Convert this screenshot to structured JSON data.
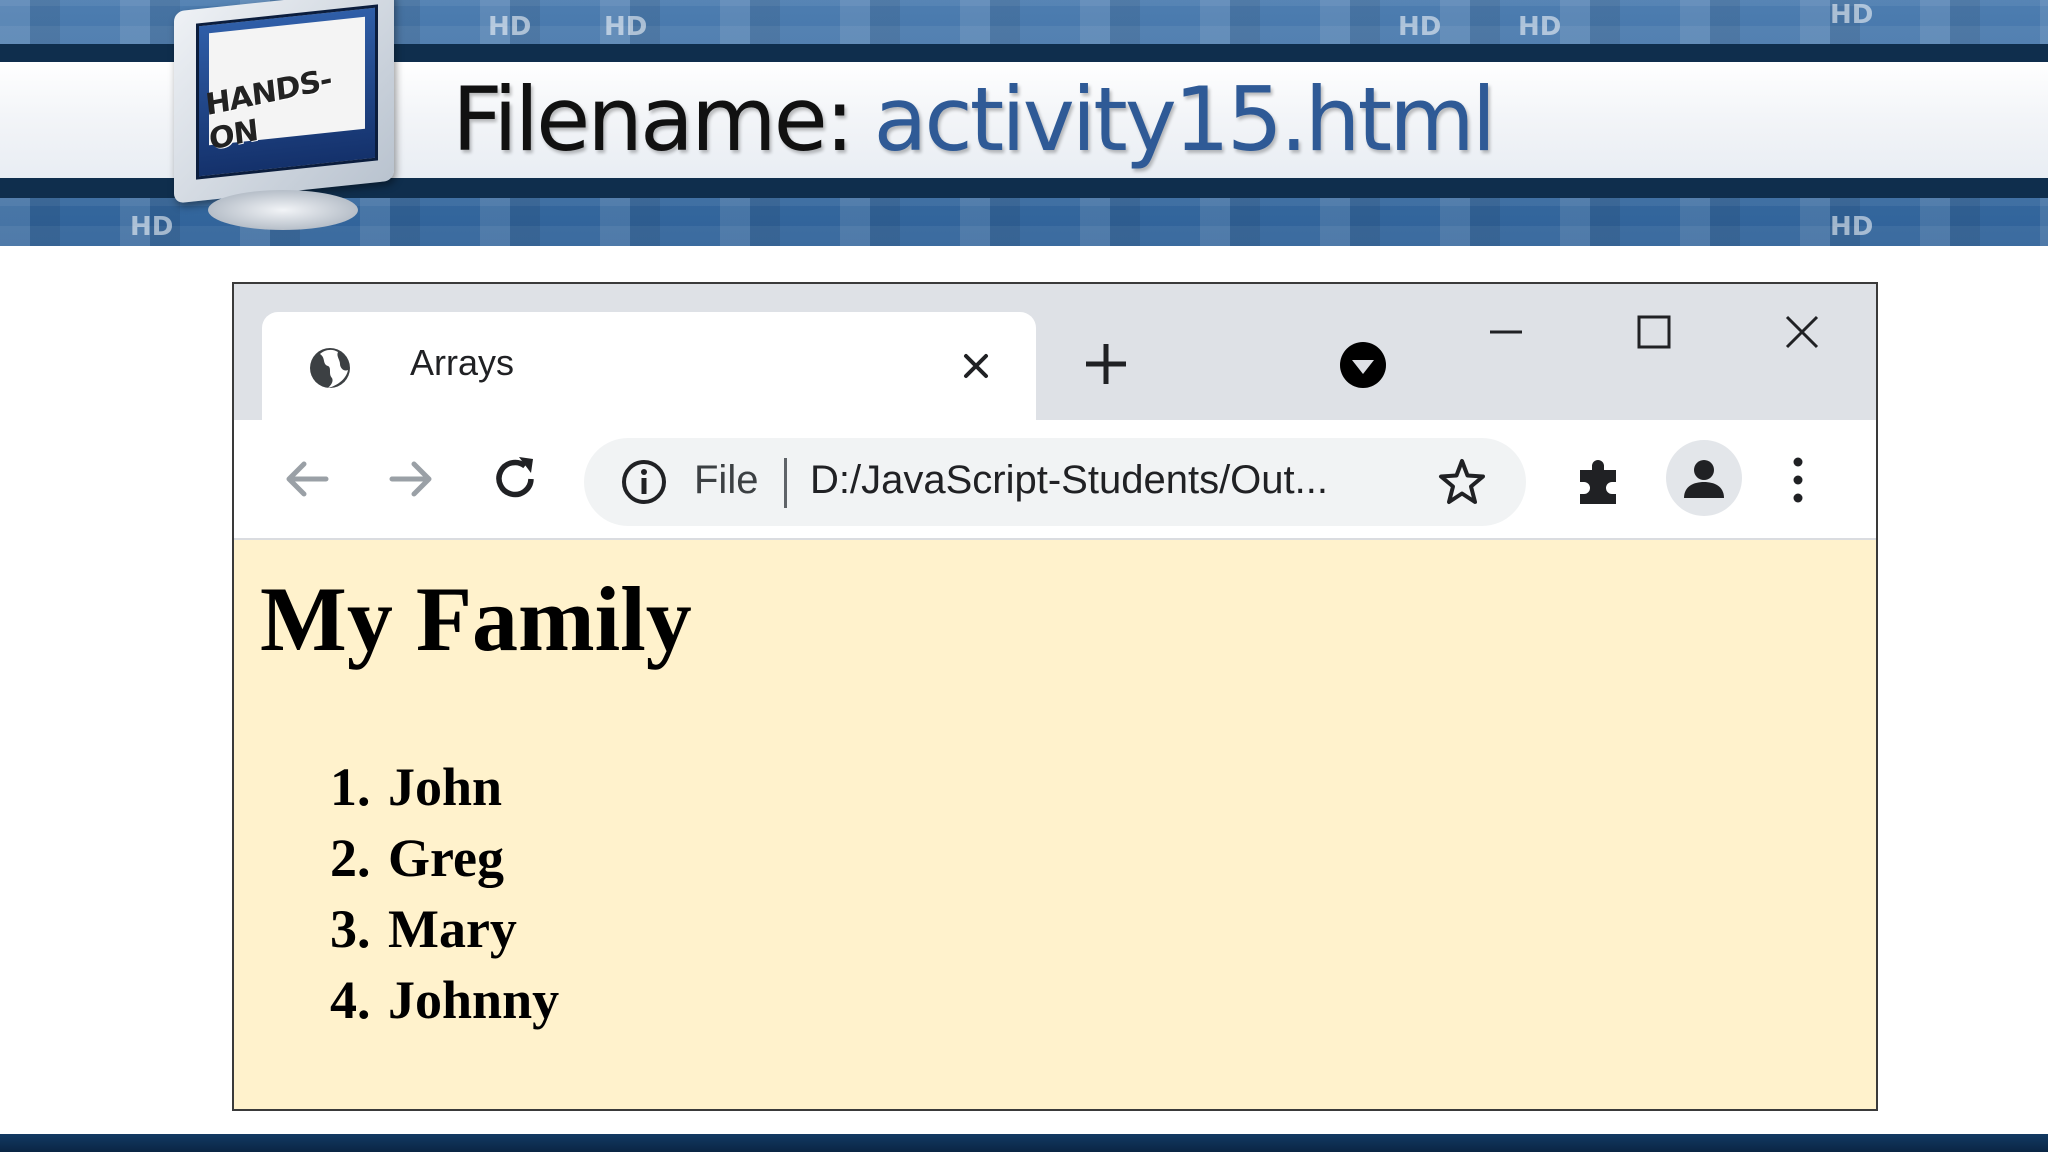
{
  "slide": {
    "title_label": "Filename:",
    "title_value": "activity15.html",
    "logo_text": "HANDS-ON",
    "banner_mark": "HD"
  },
  "browser": {
    "tab": {
      "title": "Arrays",
      "favicon": "globe-icon"
    },
    "toolbar": {
      "scheme": "File",
      "url": "D:/JavaScript-Students/Out...",
      "icons": [
        "back-arrow-icon",
        "forward-arrow-icon",
        "reload-icon",
        "info-icon",
        "star-icon",
        "extensions-puzzle-icon",
        "profile-icon",
        "kebab-menu-icon"
      ]
    },
    "window_controls": [
      "minimize-icon",
      "maximize-icon",
      "close-icon"
    ]
  },
  "page": {
    "heading": "My Family",
    "background": "#fff2cc",
    "family": [
      {
        "num": "1.",
        "name": "John"
      },
      {
        "num": "2.",
        "name": "Greg"
      },
      {
        "num": "3.",
        "name": "Mary"
      },
      {
        "num": "4.",
        "name": "Johnny"
      }
    ]
  },
  "colors": {
    "title_accent": "#2f5a96",
    "banner_blue": "#2f6299",
    "banner_dark": "#0f2e4d"
  }
}
